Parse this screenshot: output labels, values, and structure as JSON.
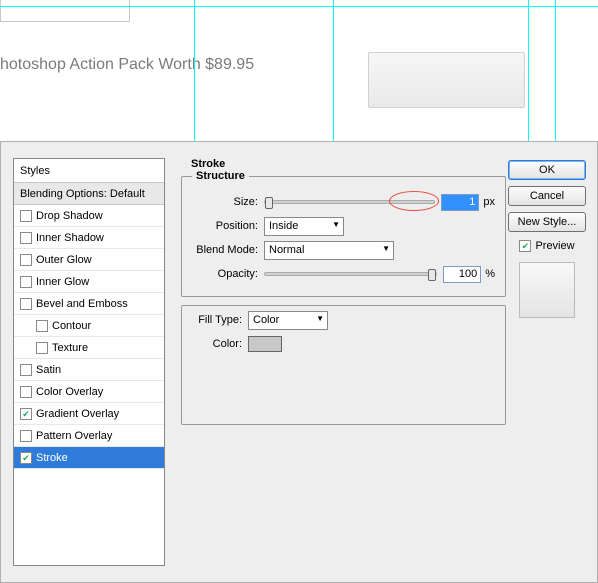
{
  "bg_text": "hotoshop Action Pack Worth $89.95",
  "guides_v": [
    194,
    333,
    528,
    555
  ],
  "guides_h": [
    6
  ],
  "styles": {
    "header": "Styles",
    "subheader": "Blending Options: Default",
    "items": [
      {
        "label": "Drop Shadow",
        "checked": false
      },
      {
        "label": "Inner Shadow",
        "checked": false
      },
      {
        "label": "Outer Glow",
        "checked": false
      },
      {
        "label": "Inner Glow",
        "checked": false
      },
      {
        "label": "Bevel and Emboss",
        "checked": false
      },
      {
        "label": "Contour",
        "checked": false,
        "indent": true
      },
      {
        "label": "Texture",
        "checked": false,
        "indent": true
      },
      {
        "label": "Satin",
        "checked": false
      },
      {
        "label": "Color Overlay",
        "checked": false
      },
      {
        "label": "Gradient Overlay",
        "checked": true
      },
      {
        "label": "Pattern Overlay",
        "checked": false
      },
      {
        "label": "Stroke",
        "checked": true,
        "selected": true
      }
    ]
  },
  "stroke": {
    "title": "Stroke",
    "structure_title": "Structure",
    "size_label": "Size:",
    "size_value": "1",
    "size_unit": "px",
    "position_label": "Position:",
    "position_value": "Inside",
    "blend_label": "Blend Mode:",
    "blend_value": "Normal",
    "opacity_label": "Opacity:",
    "opacity_value": "100",
    "opacity_unit": "%",
    "filltype_label": "Fill Type:",
    "filltype_value": "Color",
    "color_label": "Color:"
  },
  "buttons": {
    "ok": "OK",
    "cancel": "Cancel",
    "newstyle": "New Style...",
    "preview": "Preview"
  }
}
